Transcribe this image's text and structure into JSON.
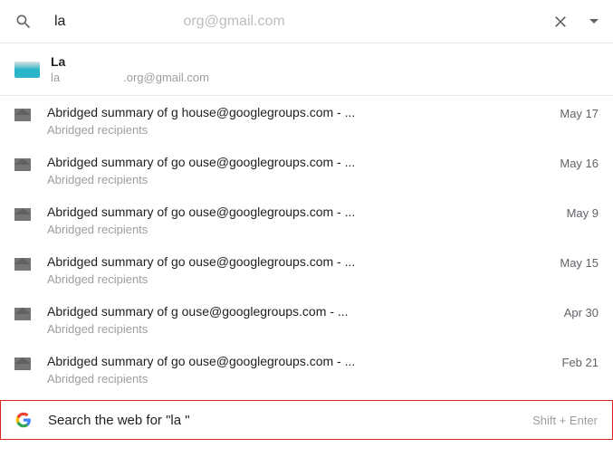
{
  "search": {
    "typed": "la",
    "hint": "org@gmail.com"
  },
  "contact": {
    "name": "La",
    "email_prefix": "la",
    "email_suffix": ".org@gmail.com"
  },
  "results": [
    {
      "title": "Abridged summary of g          house@googlegroups.com - ...",
      "sub": "Abridged recipients",
      "date": "May 17"
    },
    {
      "title": "Abridged summary of go           ouse@googlegroups.com - ...",
      "sub": "Abridged recipients",
      "date": "May 16"
    },
    {
      "title": "Abridged summary of go          ouse@googlegroups.com - ...",
      "sub": "Abridged recipients",
      "date": "May 9"
    },
    {
      "title": "Abridged summary of go           ouse@googlegroups.com - ...",
      "sub": "Abridged recipients",
      "date": "May 15"
    },
    {
      "title": "Abridged summary of g           ouse@googlegroups.com - ...",
      "sub": "Abridged recipients",
      "date": "Apr 30"
    },
    {
      "title": "Abridged summary of go          ouse@googlegroups.com - ...",
      "sub": "Abridged recipients",
      "date": "Feb 21"
    }
  ],
  "web": {
    "label": "Search the web for \"la    \"",
    "hint": "Shift + Enter"
  }
}
